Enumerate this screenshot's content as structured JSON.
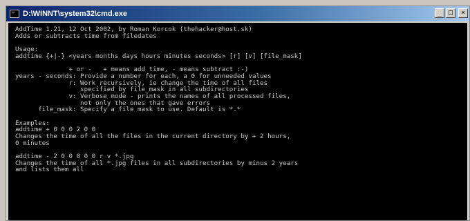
{
  "window": {
    "title": "D:\\WINNT\\system32\\cmd.exe",
    "controls": {
      "minimize": "_",
      "maximize": "□",
      "close": "×"
    }
  },
  "console": {
    "lines": [
      "AddTime 1.21, 12 Oct 2002, by Roman Korcok (thehacker@host.sk)",
      "Adds or subtracts time from filedates",
      "",
      "Usage:",
      "addtime {+|-} <years months days hours minutes seconds> [r] [v] [file_mask]",
      "",
      "              + or -   + means add time, - means subtract :-)",
      "years - seconds: Provide a number for each, a 0 for unneeded values",
      "              r: Work recursively, ie change the time of all files",
      "                 specified by file_mask in all subdirectories",
      "              v: Verbose mode - prints the names of all processed files,",
      "                 not only the ones that gave errors",
      "      file_mask: Specify a file mask to use. Default is *.*",
      "",
      "Examples:",
      "addtime + 0 0 0 2 0 0",
      "Changes the time of all the files in the current directory by + 2 hours,",
      "0 minutes",
      "",
      "addtime - 2 0 0 0 0 0 r v *.jpg",
      "Changes the time of all *.jpg files in all subdirectories by minus 2 years",
      "and lists them all"
    ]
  }
}
